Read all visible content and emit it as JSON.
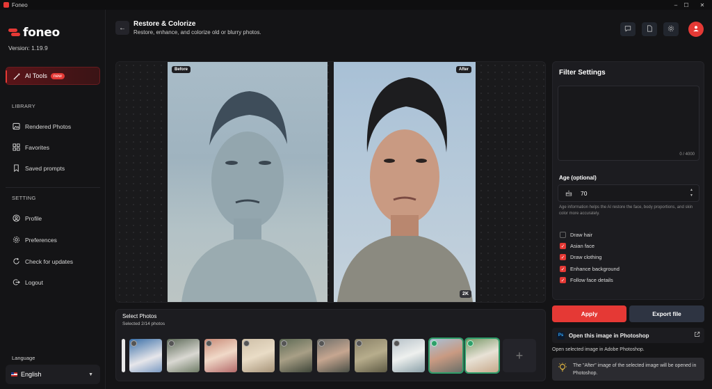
{
  "window": {
    "title": "Foneo",
    "controls": [
      "–",
      "☐",
      "✕"
    ]
  },
  "sidebar": {
    "logo_text": "foneo",
    "version": "Version: 1.19.9",
    "ai_tools_label": "AI Tools",
    "ai_tools_badge": "new",
    "library_heading": "LIBRARY",
    "library_items": [
      "Rendered Photos",
      "Favorites",
      "Saved prompts"
    ],
    "setting_heading": "SETTING",
    "setting_items": [
      "Profile",
      "Preferences",
      "Check for updates",
      "Logout"
    ],
    "language_label": "Language",
    "language_value": "English"
  },
  "header": {
    "title": "Restore & Colorize",
    "subtitle": "Restore, enhance, and colorize old or blurry photos."
  },
  "viewer": {
    "before_tag": "Before",
    "after_tag": "After",
    "resolution_badge": "2K"
  },
  "tray": {
    "title": "Select Photos",
    "subtitle": "Selected 2/14 photos",
    "thumbnails": [
      {
        "selected": false
      },
      {
        "selected": false
      },
      {
        "selected": false
      },
      {
        "selected": false
      },
      {
        "selected": false
      },
      {
        "selected": false
      },
      {
        "selected": false
      },
      {
        "selected": false
      },
      {
        "selected": true
      },
      {
        "selected": true
      }
    ],
    "add_label": "+"
  },
  "filter": {
    "title": "Filter Settings",
    "prompt_counter": "0 / 4000",
    "age_label": "Age (optional)",
    "age_value": "70",
    "age_help": "Age information helps the AI restore the face, body proportions, and skin color more accurately.",
    "options": [
      {
        "label": "Draw hair",
        "checked": false
      },
      {
        "label": "Asian face",
        "checked": true
      },
      {
        "label": "Draw clothing",
        "checked": true
      },
      {
        "label": "Enhance background",
        "checked": true
      },
      {
        "label": "Follow face details",
        "checked": true
      }
    ]
  },
  "actions": {
    "apply": "Apply",
    "export": "Export file",
    "photoshop_label": "Open this image in Photoshop",
    "photoshop_icon_text": "Ps",
    "photoshop_desc": "Open selected image in Adobe Photoshop.",
    "info_text": "The \"After\" image of the selected image will be opened in Photoshop."
  },
  "colors": {
    "accent": "#e53935",
    "selected_outline": "#2e9e6a",
    "export_bg": "#2e3442"
  }
}
